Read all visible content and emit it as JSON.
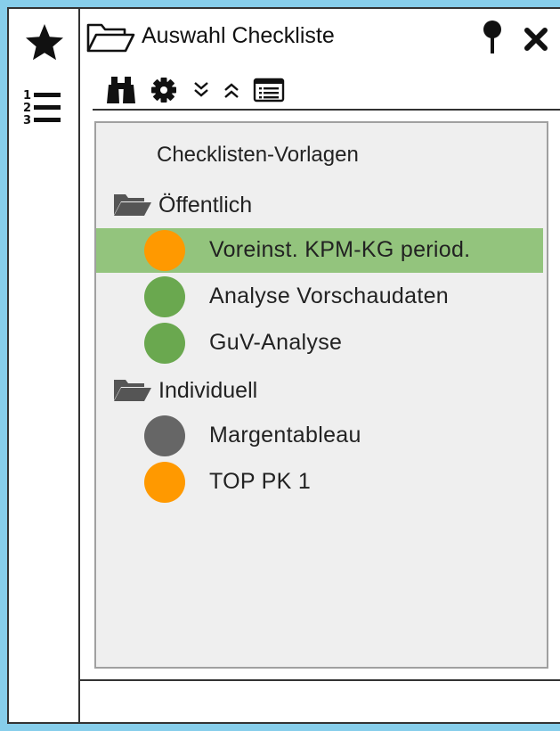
{
  "panel": {
    "title": "Auswahl Checkliste"
  },
  "sidebar": {
    "items": [
      {
        "name": "favorites",
        "icon": "star-icon"
      },
      {
        "name": "numbered-list",
        "icon": "numbered-list-icon"
      }
    ]
  },
  "titlebar": {
    "pin_icon": "pin-icon",
    "close_icon": "close-icon"
  },
  "toolbar": {
    "buttons": [
      {
        "name": "search",
        "icon": "binoculars-icon"
      },
      {
        "name": "settings",
        "icon": "gear-icon"
      },
      {
        "name": "expand-all",
        "icon": "double-chevron-down-icon"
      },
      {
        "name": "collapse-all",
        "icon": "double-chevron-up-icon"
      },
      {
        "name": "list-view",
        "icon": "list-view-icon"
      }
    ]
  },
  "tree": {
    "root_label": "Checklisten-Vorlagen",
    "groups": [
      {
        "label": "Öffentlich",
        "items": [
          {
            "label": "Voreinst. KPM-KG period.",
            "status_color": "#ff9900",
            "selected": true
          },
          {
            "label": "Analyse Vorschaudaten",
            "status_color": "#6aa84f",
            "selected": false
          },
          {
            "label": "GuV-Analyse",
            "status_color": "#6aa84f",
            "selected": false
          }
        ]
      },
      {
        "label": "Individuell",
        "items": [
          {
            "label": "Margentableau",
            "status_color": "#666666",
            "selected": false
          },
          {
            "label": "TOP PK 1",
            "status_color": "#ff9900",
            "selected": false
          }
        ]
      }
    ]
  },
  "colors": {
    "selection": "#93c47d",
    "background": "#87ceeb",
    "tree_bg": "#efefef"
  }
}
